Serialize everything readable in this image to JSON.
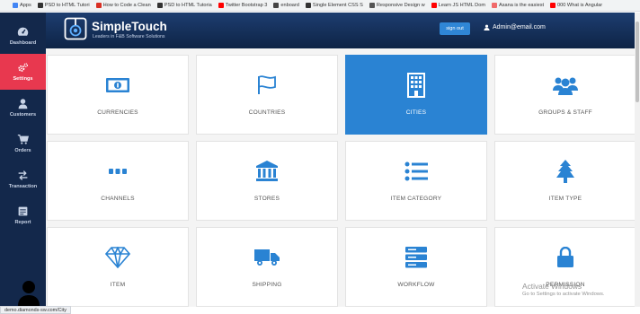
{
  "bookmarks": [
    {
      "label": "Apps",
      "color": "#4285f4"
    },
    {
      "label": "PSD to HTML Tutori",
      "color": "#333333"
    },
    {
      "label": "How to Code a Clean",
      "color": "#d93025"
    },
    {
      "label": "PSD to HTML Tutoria",
      "color": "#333333"
    },
    {
      "label": "Twitter Bootstrap 3",
      "color": "#ff0000"
    },
    {
      "label": "enboard",
      "color": "#444444"
    },
    {
      "label": "Single Element CSS S",
      "color": "#333333"
    },
    {
      "label": "Responsive Design w",
      "color": "#555555"
    },
    {
      "label": "Learn JS HTML Dom",
      "color": "#ff0000"
    },
    {
      "label": "Asana is the easiest",
      "color": "#f06a6a"
    },
    {
      "label": "000 What is Angular",
      "color": "#ff0000"
    }
  ],
  "sidebar": {
    "items": [
      {
        "label": "Dashboard",
        "icon": "dashboard-icon",
        "active": false
      },
      {
        "label": "Settings",
        "icon": "cogs-icon",
        "active": true
      },
      {
        "label": "Customers",
        "icon": "user-icon",
        "active": false
      },
      {
        "label": "Orders",
        "icon": "cart-icon",
        "active": false
      },
      {
        "label": "Transaction",
        "icon": "exchange-icon",
        "active": false
      },
      {
        "label": "Report",
        "icon": "report-icon",
        "active": false
      }
    ]
  },
  "header": {
    "brand": "SimpleTouch",
    "tagline": "Leaders in F&B Software Solutions",
    "signout_label": "sign out",
    "user_email": "Admin@email.com"
  },
  "tiles": [
    {
      "label": "CURRENCIES",
      "icon": "money-icon",
      "active": false
    },
    {
      "label": "COUNTRIES",
      "icon": "flag-icon",
      "active": false
    },
    {
      "label": "CITIES",
      "icon": "building-icon",
      "active": true
    },
    {
      "label": "GROUPS & STAFF",
      "icon": "users-icon",
      "active": false
    },
    {
      "label": "CHANNELS",
      "icon": "ellipsis-icon",
      "active": false
    },
    {
      "label": "STORES",
      "icon": "bank-icon",
      "active": false
    },
    {
      "label": "ITEM CATEGORY",
      "icon": "list-icon",
      "active": false
    },
    {
      "label": "ITEM TYPE",
      "icon": "tree-icon",
      "active": false
    },
    {
      "label": "ITEM",
      "icon": "diamond-icon",
      "active": false
    },
    {
      "label": "SHIPPING",
      "icon": "truck-icon",
      "active": false
    },
    {
      "label": "WORKFLOW",
      "icon": "server-icon",
      "active": false
    },
    {
      "label": "PERMISSION",
      "icon": "lock-icon",
      "active": false
    }
  ],
  "status_url": "demo.diamonds-sw.com/City",
  "watermark": {
    "title": "Activate Windows",
    "subtitle": "Go to Settings to activate Windows."
  },
  "colors": {
    "sidebar_bg": "#13284b",
    "active_nav": "#e8384f",
    "accent_blue": "#2a83d3",
    "header_bg": "#1d3d70"
  }
}
